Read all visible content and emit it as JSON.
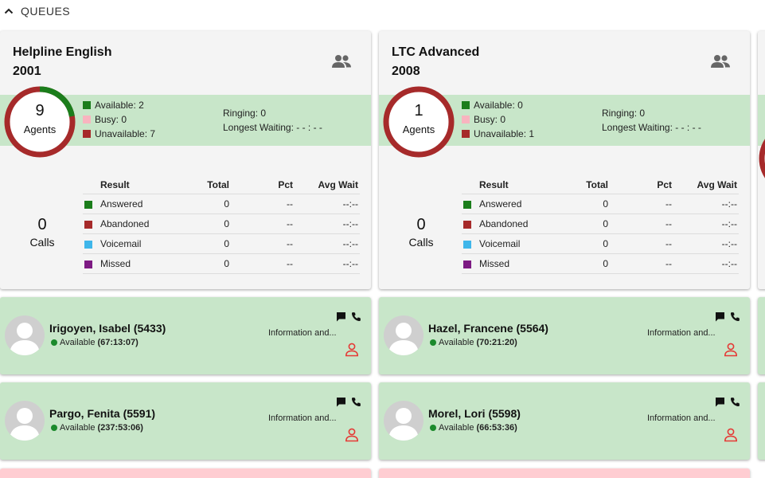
{
  "section": {
    "title": "QUEUES",
    "collapse_icon": "chevron-up-icon"
  },
  "colors": {
    "available": "#1b7d1b",
    "busy": "#f8b4bf",
    "unavailable": "#a62a2a",
    "answered": "#1b7d1b",
    "abandoned": "#a62a2a",
    "voicemail": "#3fb6ea",
    "missed": "#7d1a83",
    "agent_card_bg": "#c8e6c9",
    "pink_card_bg": "#ffcdd2",
    "person_icon": "#e53935"
  },
  "queues": [
    {
      "name": "Helpline English",
      "number": "2001",
      "agents_total": "9",
      "agents_label": "Agents",
      "available": 2,
      "busy": 0,
      "unavailable": 7,
      "available_label": "Available: 2",
      "busy_label": "Busy: 0",
      "unavailable_label": "Unavailable: 7",
      "ringing": "Ringing: 0",
      "longest_waiting": "Longest Waiting: - - : - -",
      "calls_total": "0",
      "calls_label": "Calls",
      "table_headers": {
        "result": "Result",
        "total": "Total",
        "pct": "Pct",
        "avg_wait": "Avg Wait"
      },
      "rows": [
        {
          "result": "Answered",
          "total": "0",
          "pct": "--",
          "avg_wait": "--:--"
        },
        {
          "result": "Abandoned",
          "total": "0",
          "pct": "--",
          "avg_wait": "--:--"
        },
        {
          "result": "Voicemail",
          "total": "0",
          "pct": "--",
          "avg_wait": "--:--"
        },
        {
          "result": "Missed",
          "total": "0",
          "pct": "--",
          "avg_wait": "--:--"
        }
      ]
    },
    {
      "name": "LTC Advanced",
      "number": "2008",
      "agents_total": "1",
      "agents_label": "Agents",
      "available": 0,
      "busy": 0,
      "unavailable": 1,
      "available_label": "Available: 0",
      "busy_label": "Busy: 0",
      "unavailable_label": "Unavailable: 1",
      "ringing": "Ringing: 0",
      "longest_waiting": "Longest Waiting: - - : - -",
      "calls_total": "0",
      "calls_label": "Calls",
      "table_headers": {
        "result": "Result",
        "total": "Total",
        "pct": "Pct",
        "avg_wait": "Avg Wait"
      },
      "rows": [
        {
          "result": "Answered",
          "total": "0",
          "pct": "--",
          "avg_wait": "--:--"
        },
        {
          "result": "Abandoned",
          "total": "0",
          "pct": "--",
          "avg_wait": "--:--"
        },
        {
          "result": "Voicemail",
          "total": "0",
          "pct": "--",
          "avg_wait": "--:--"
        },
        {
          "result": "Missed",
          "total": "0",
          "pct": "--",
          "avg_wait": "--:--"
        }
      ]
    }
  ],
  "agents": [
    {
      "name": "Irigoyen, Isabel (5433)",
      "status": "Available",
      "duration": "(67:13:07)",
      "info": "Information and..."
    },
    {
      "name": "Hazel, Francene (5564)",
      "status": "Available",
      "duration": "(70:21:20)",
      "info": "Information and..."
    },
    {
      "name": "Pargo, Fenita (5591)",
      "status": "Available",
      "duration": "(237:53:06)",
      "info": "Information and..."
    },
    {
      "name": "Morel, Lori (5598)",
      "status": "Available",
      "duration": "(66:53:36)",
      "info": "Information and..."
    }
  ]
}
